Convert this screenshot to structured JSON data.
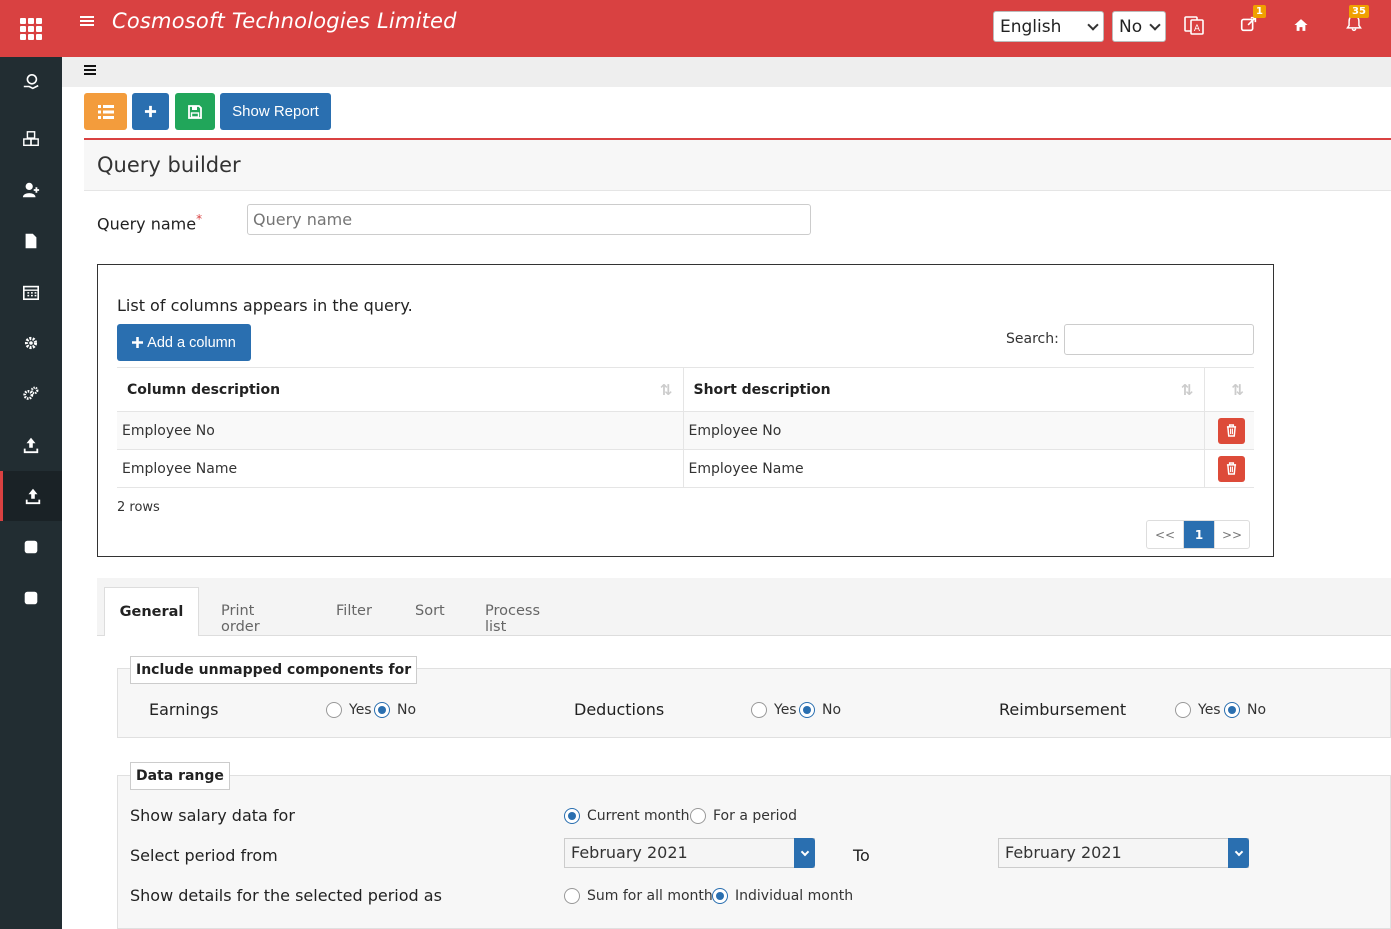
{
  "header": {
    "title": "Cosmosoft Technologies Limited",
    "language": "English",
    "toggle_value": "No",
    "notification_badge_1": "1",
    "notification_badge_2": "35"
  },
  "toolbar": {
    "show_report_label": "Show Report"
  },
  "page": {
    "title": "Query builder",
    "query_name_label": "Query name",
    "required_mark": "*",
    "query_name_placeholder": "Query name"
  },
  "columns_box": {
    "title": "List of columns appears in the query.",
    "add_label": "Add a column",
    "search_label": "Search:",
    "headers": [
      "Column description",
      "Short description"
    ],
    "rows": [
      {
        "column": "Employee No",
        "short": "Employee No"
      },
      {
        "column": "Employee Name",
        "short": "Employee Name"
      }
    ],
    "rows_info": "2 rows",
    "pager": {
      "prev": "<<",
      "current": "1",
      "next": ">>"
    }
  },
  "tabs": [
    "General",
    "Print order",
    "Filter",
    "Sort",
    "Process list"
  ],
  "unmapped": {
    "legend": "Include unmapped components for",
    "groups": [
      {
        "label": "Earnings",
        "yes": "Yes",
        "no": "No",
        "selected": "No"
      },
      {
        "label": "Deductions",
        "yes": "Yes",
        "no": "No",
        "selected": "No"
      },
      {
        "label": "Reimbursement",
        "yes": "Yes",
        "no": "No",
        "selected": "No"
      }
    ]
  },
  "data_range": {
    "legend": "Data range",
    "show_salary_label": "Show salary data for",
    "opt_current": "Current month",
    "opt_period": "For a period",
    "select_period_label": "Select period from",
    "from_value": "February 2021",
    "to_label": "To",
    "to_value": "February 2021",
    "details_label": "Show details for the selected period as",
    "opt_sum": "Sum for all month",
    "opt_individual": "Individual month"
  },
  "colors": {
    "brand_red": "#d94141",
    "sidebar": "#222d32",
    "primary_blue": "#2a6fb0",
    "orange": "#f39c3c",
    "green": "#21a65a",
    "danger": "#dd4b39"
  }
}
